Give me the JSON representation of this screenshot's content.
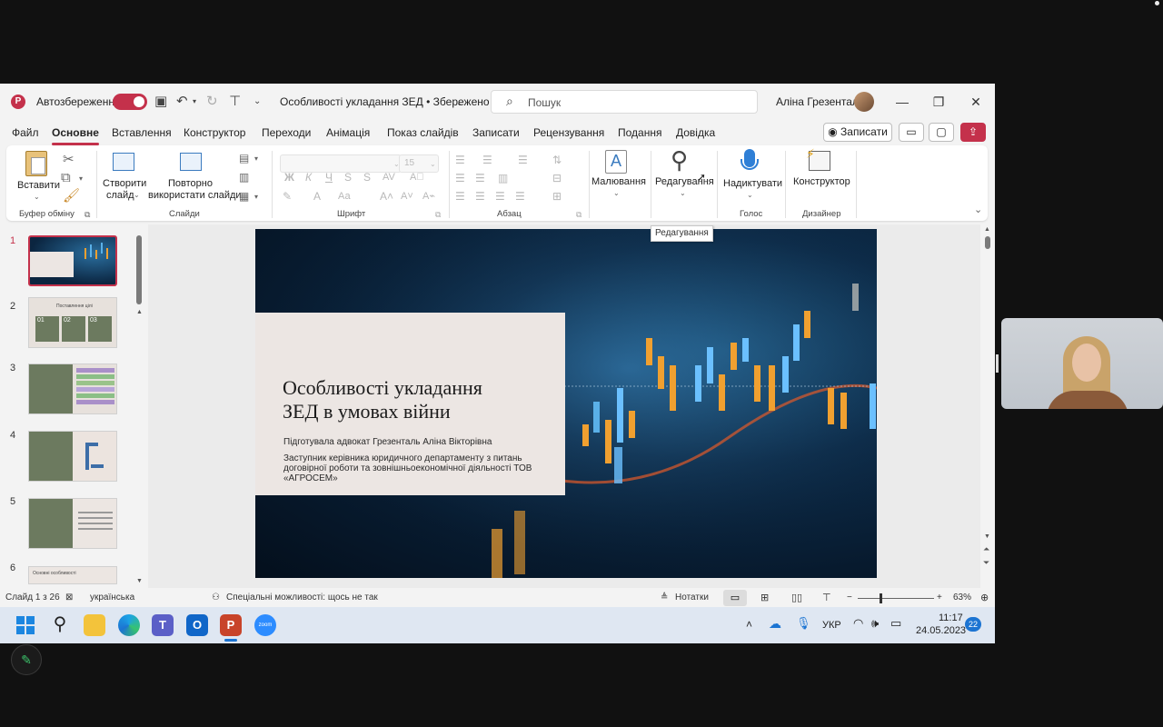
{
  "titlebar": {
    "autosave_label": "Автозбереження",
    "doc_title": "Особливості укладання ЗЕД • Збережено",
    "search_placeholder": "Пошук",
    "user_name": "Аліна Грезенталь"
  },
  "menu": {
    "items": [
      "Файл",
      "Основне",
      "Вставлення",
      "Конструктор",
      "Переходи",
      "Анімація",
      "Показ слайдів",
      "Записати",
      "Рецензування",
      "Подання",
      "Довідка"
    ],
    "record_button": "Записати"
  },
  "ribbon": {
    "paste": "Вставити",
    "group_clipboard": "Буфер обміну",
    "new_slide_1": "Створити",
    "new_slide_2": "слайд",
    "reuse_1": "Повторно",
    "reuse_2": "використати слайди",
    "group_slides": "Слайди",
    "font_size": "15",
    "group_font": "Шрифт",
    "group_paragraph": "Абзац",
    "draw": "Малювання",
    "edit": "Редагування",
    "dictate": "Надиктувати",
    "group_voice": "Голос",
    "designer": "Конструктор",
    "group_designer": "Дизайнер",
    "tooltip": "Редагування"
  },
  "thumbnails": {
    "numbers": [
      "1",
      "2",
      "3",
      "4",
      "5",
      "6"
    ],
    "t2_title": "Поставлення цілі",
    "t2_boxes": [
      "01",
      "02",
      "03"
    ],
    "t6_title": "Основні особливості"
  },
  "slide": {
    "title_line1": "Особливості укладання",
    "title_line2": "ЗЕД в умовах війни",
    "author": "Підготувала адвокат Грезенталь Аліна Вікторівна",
    "position_1": "Заступник керівника юридичного департаменту з питань",
    "position_2": "договірної роботи та зовнішньоекономічної діяльності ТОВ",
    "position_3": "«АГРОСЕМ»"
  },
  "status": {
    "slide_count": "Слайд 1 з 26",
    "language": "українська",
    "accessibility": "Спеціальні можливості: щось не так",
    "notes": "Нотатки",
    "zoom": "63%"
  },
  "taskbar": {
    "lang": "УКР",
    "time": "11:17",
    "date": "24.05.2023",
    "notif": "22"
  },
  "colors": {
    "accent": "#c4314b",
    "slide_bg": "#0d2c4a",
    "card": "#ece6e3",
    "thumb_green": "#6c7a5f"
  }
}
